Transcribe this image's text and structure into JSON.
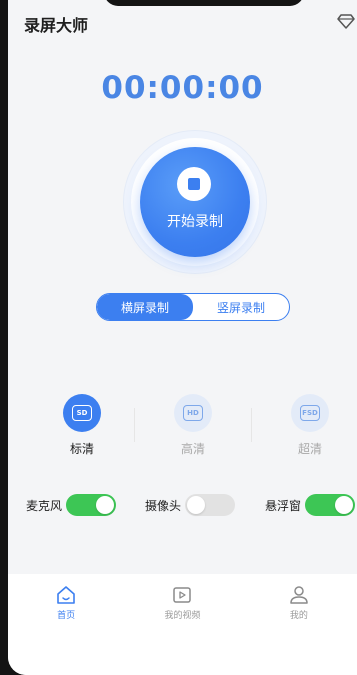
{
  "app": {
    "title": "录屏大师"
  },
  "timer": {
    "value": "00:00:00"
  },
  "record": {
    "label": "开始录制"
  },
  "orientation": {
    "options": [
      {
        "label": "横屏录制",
        "active": true
      },
      {
        "label": "竖屏录制",
        "active": false
      }
    ]
  },
  "quality": {
    "options": [
      {
        "badge": "SD",
        "label": "标清",
        "active": true
      },
      {
        "badge": "HD",
        "label": "高清",
        "active": false
      },
      {
        "badge": "FSD",
        "label": "超清",
        "active": false
      }
    ]
  },
  "switches": [
    {
      "label": "麦克风",
      "on": true
    },
    {
      "label": "摄像头",
      "on": false
    },
    {
      "label": "悬浮窗",
      "on": true
    }
  ],
  "nav": {
    "items": [
      {
        "label": "首页",
        "icon": "home-icon",
        "active": true
      },
      {
        "label": "我的视频",
        "icon": "video-icon",
        "active": false
      },
      {
        "label": "我的",
        "icon": "user-icon",
        "active": false
      }
    ]
  },
  "colors": {
    "accent": "#3c7ff0",
    "switch_on": "#3dc655",
    "timer": "#4a86e4"
  }
}
